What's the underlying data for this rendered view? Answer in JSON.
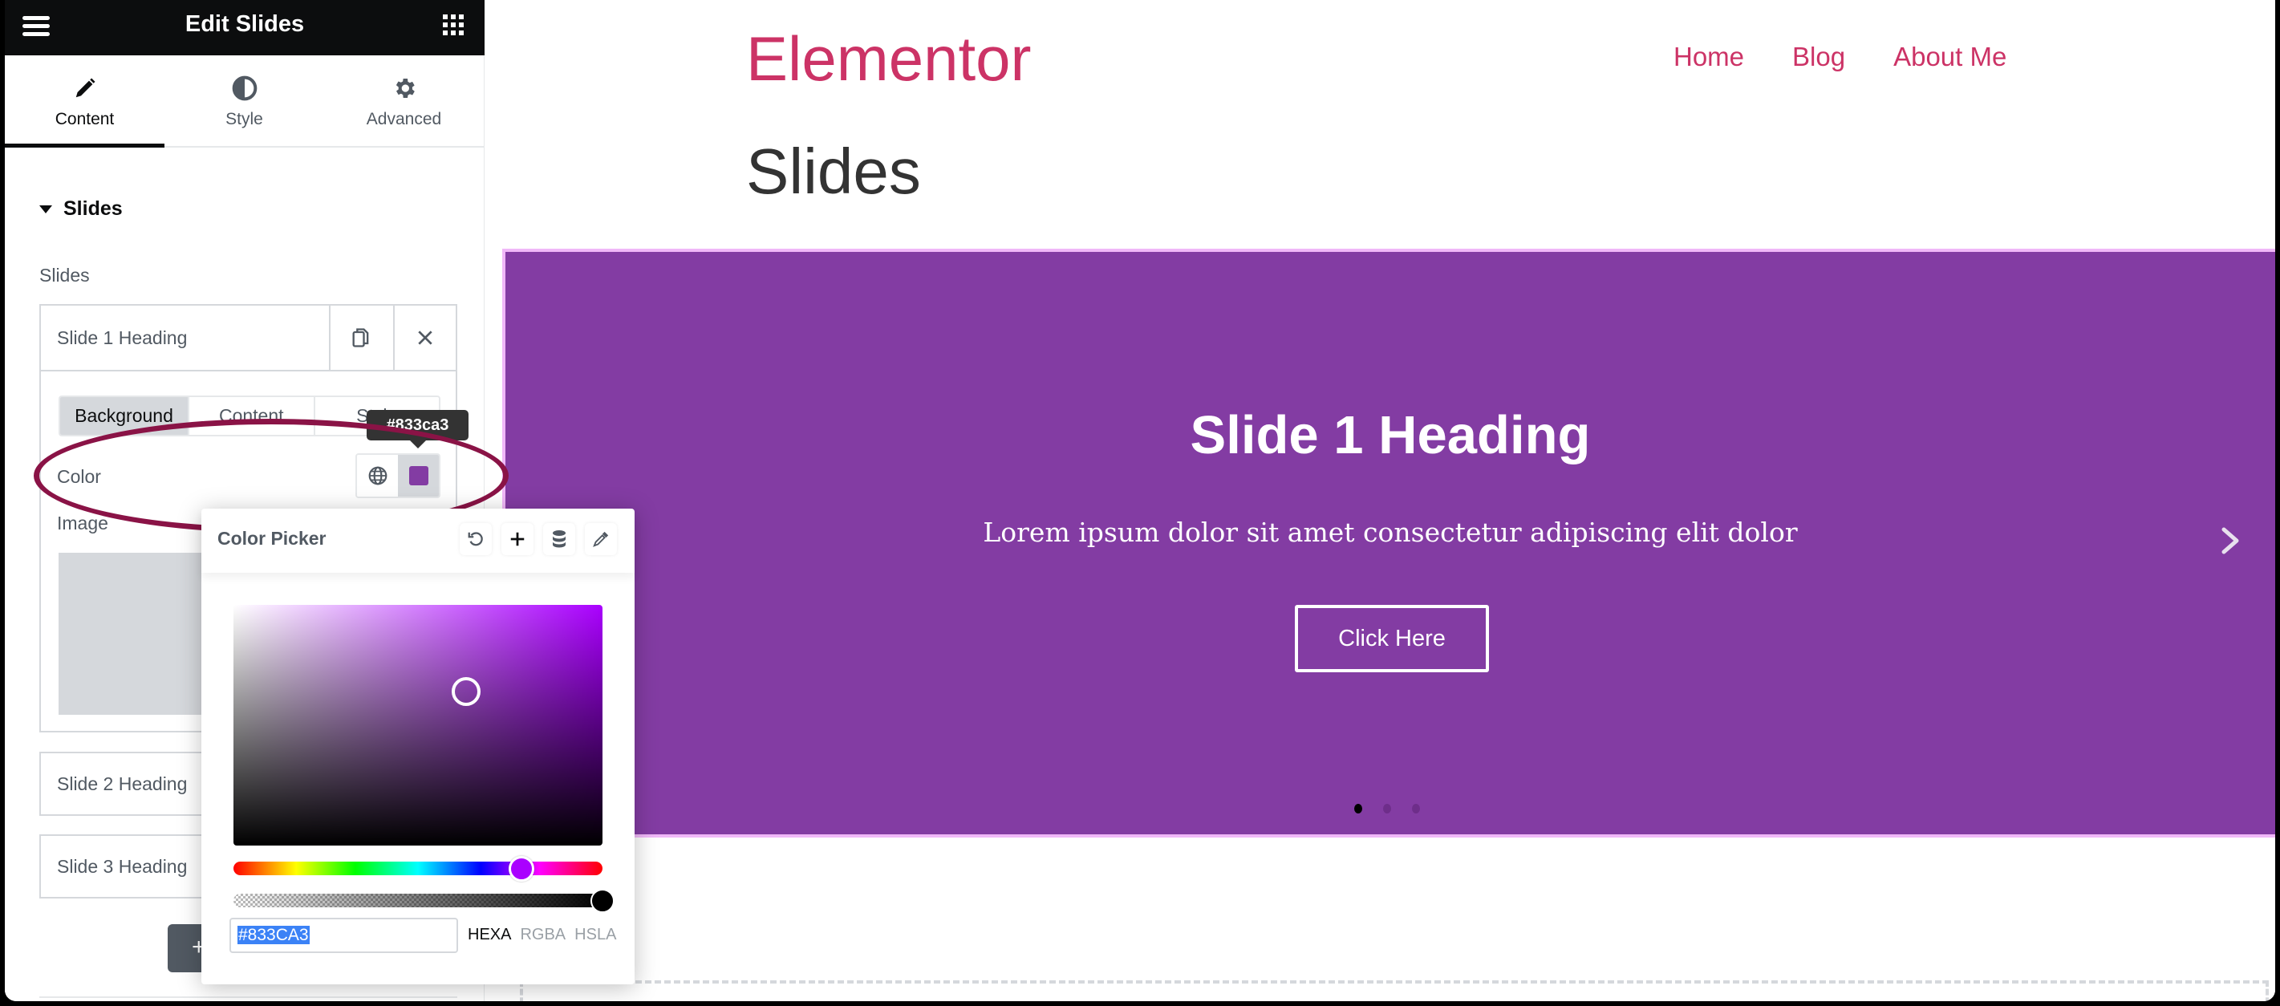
{
  "panel": {
    "title": "Edit Slides",
    "tabs": [
      {
        "label": "Content",
        "icon": "pencil-icon",
        "active": true
      },
      {
        "label": "Style",
        "icon": "half-circle-icon",
        "active": false
      },
      {
        "label": "Advanced",
        "icon": "gear-icon",
        "active": false
      }
    ],
    "section_title": "Slides",
    "slides_label": "Slides",
    "slides": [
      {
        "title": "Slide 1 Heading",
        "expanded": true
      },
      {
        "title": "Slide 2 Heading",
        "expanded": false
      },
      {
        "title": "Slide 3 Heading",
        "expanded": false
      }
    ],
    "inner_tabs": [
      {
        "label": "Background",
        "active": true
      },
      {
        "label": "Content",
        "active": false
      },
      {
        "label": "Style",
        "active": false
      }
    ],
    "color_label": "Color",
    "image_label": "Image",
    "color_value": "#833ca3",
    "tooltip": "#833ca3",
    "add_item_label": "+"
  },
  "color_picker": {
    "title": "Color Picker",
    "tools": [
      "reset-icon",
      "add-icon",
      "database-icon",
      "eyedropper-icon"
    ],
    "hex_value": "#833CA3",
    "formats": [
      {
        "label": "HEXA",
        "active": true
      },
      {
        "label": "RGBA",
        "active": false
      },
      {
        "label": "HSLA",
        "active": false
      }
    ],
    "hue_fraction": 0.78,
    "alpha_fraction": 1.0,
    "saturation_fraction": 0.63,
    "value_fraction": 0.64
  },
  "preview": {
    "logo": "Elementor",
    "nav": [
      "Home",
      "Blog",
      "About Me"
    ],
    "page_title": "Slides",
    "slide": {
      "heading": "Slide 1 Heading",
      "description": "Lorem ipsum dolor sit amet consectetur adipiscing elit dolor",
      "button": "Click Here"
    },
    "slide_count": 3,
    "active_slide": 0
  },
  "colors": {
    "brand_pink": "#cc3366",
    "slide_bg": "#833ca3",
    "annotation": "#8a1346"
  }
}
